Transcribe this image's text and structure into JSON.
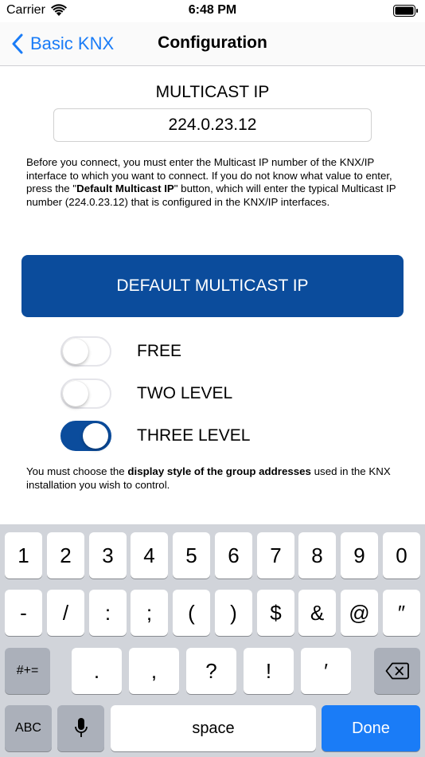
{
  "status_bar": {
    "carrier": "Carrier",
    "time": "6:48 PM"
  },
  "nav": {
    "back_label": "Basic KNX",
    "title": "Configuration"
  },
  "multicast": {
    "section_title": "MULTICAST IP",
    "ip_value": "224.0.23.12",
    "help_part1": "Before you connect, you must enter the Multicast IP number of the KNX/IP interface to which you want to connect. If you do not know what value to enter, press the \"",
    "help_bold": "Default Multicast IP",
    "help_part2": "\" button, which will enter the typical Multicast IP number (224.0.23.12) that is configured in the KNX/IP interfaces.",
    "default_button": "DEFAULT MULTICAST IP"
  },
  "address_styles": [
    {
      "label": "FREE",
      "on": false
    },
    {
      "label": "TWO LEVEL",
      "on": false
    },
    {
      "label": "THREE LEVEL",
      "on": true
    }
  ],
  "footer": {
    "part1": "You must choose the ",
    "bold": "display style of the group addresses",
    "part2": " used in the KNX installation you wish to control."
  },
  "keyboard": {
    "row1": [
      "1",
      "2",
      "3",
      "4",
      "5",
      "6",
      "7",
      "8",
      "9",
      "0"
    ],
    "row2": [
      "-",
      "/",
      ":",
      ";",
      "(",
      ")",
      "$",
      "&",
      "@",
      "″"
    ],
    "symbols_key": "#+=",
    "row3": [
      ".",
      ",",
      "?",
      "!",
      "′"
    ],
    "abc_key": "ABC",
    "space_key": "space",
    "done_key": "Done"
  },
  "icons": {
    "back": "chevron-left-icon",
    "wifi": "wifi-icon",
    "battery": "battery-icon",
    "delete": "backspace-icon",
    "mic": "microphone-icon"
  },
  "colors": {
    "accent": "#1a7cf7",
    "brand": "#0b4c9c",
    "keyboard_bg": "#d1d4da"
  }
}
